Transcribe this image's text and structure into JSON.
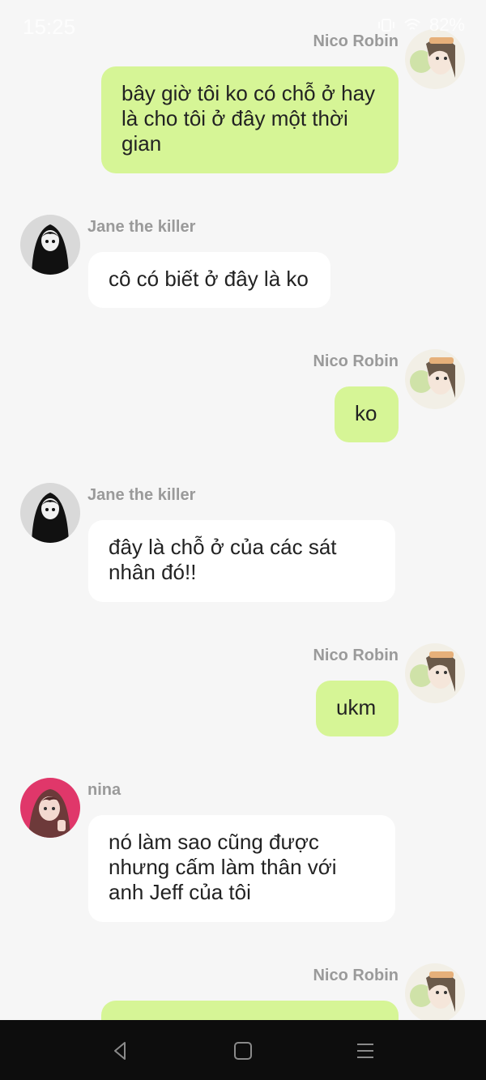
{
  "status_bar": {
    "time": "15:25",
    "battery": "82%"
  },
  "messages": [
    {
      "sender": "Nico Robin",
      "text": "bây giờ tôi ko có chỗ ở hay là cho tôi ở đây một thời gian"
    },
    {
      "sender": "Jane the killer",
      "text": "cô có biết ở đây là ko"
    },
    {
      "sender": "Nico Robin",
      "text": "ko"
    },
    {
      "sender": "Jane the killer",
      "text": "đây là chỗ ở của các sát nhân đó!!"
    },
    {
      "sender": "Nico Robin",
      "text": "ukm"
    },
    {
      "sender": "nina",
      "text": "nó làm sao cũng được nhưng cấm làm thân với anh Jeff của tôi"
    },
    {
      "sender": "Nico Robin",
      "text": ""
    }
  ],
  "colors": {
    "my_bubble": "#d6f596",
    "other_bubble": "#ffffff",
    "background": "#f6f6f6",
    "nav_bar": "#0d0d0d"
  },
  "nav": {
    "back": "back-icon",
    "home": "home-icon",
    "menu": "recent-apps-icon"
  }
}
